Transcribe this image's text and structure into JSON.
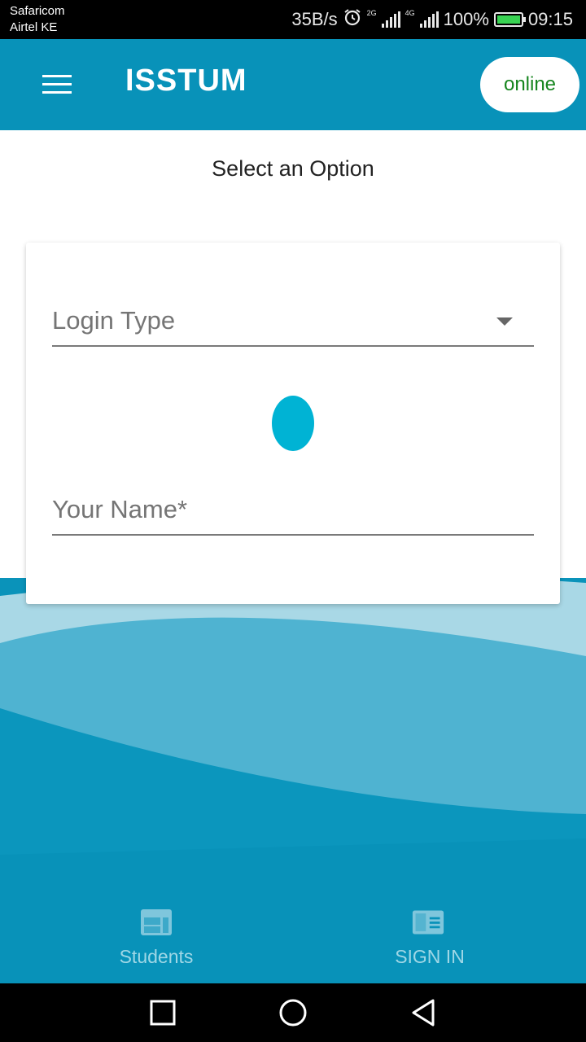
{
  "status_bar": {
    "carrier_1": "Safaricom",
    "carrier_2": "Airtel KE",
    "net_speed": "35B/s",
    "sim1_tech": "2G",
    "sim2_tech": "4G",
    "battery": "100%",
    "time": "09:15"
  },
  "app_bar": {
    "title": "ISSTUM",
    "status_pill": "online"
  },
  "main": {
    "subtitle": "Select an Option"
  },
  "form": {
    "login_type_label": "Login Type",
    "name_placeholder": "Your Name*",
    "name_value": ""
  },
  "bottom_nav": {
    "items": [
      {
        "label": "Students",
        "icon": "students-icon"
      },
      {
        "label": "SIGN IN",
        "icon": "sign-in-icon"
      }
    ]
  },
  "colors": {
    "primary": "#0892b9",
    "accent": "#00b3d4",
    "online_text": "#16851e",
    "nav_label": "#9fd7e6"
  }
}
